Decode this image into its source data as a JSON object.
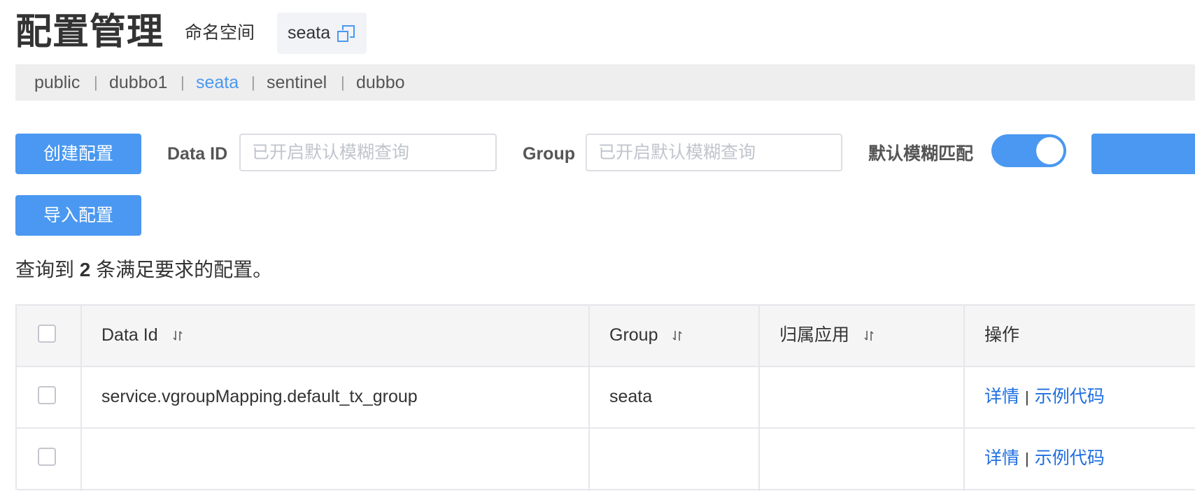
{
  "page": {
    "title": "配置管理"
  },
  "namespace": {
    "label": "命名空间",
    "current": "seata",
    "icon": "copy-icon",
    "tabs": [
      {
        "label": "public"
      },
      {
        "label": "dubbo1"
      },
      {
        "label": "seata"
      },
      {
        "label": "sentinel"
      },
      {
        "label": "dubbo"
      }
    ],
    "active_tab": "seata",
    "separator": "|"
  },
  "toolbar": {
    "create_label": "创建配置",
    "import_label": "导入配置",
    "dataid_label": "Data ID",
    "dataid_placeholder": "已开启默认模糊查询",
    "group_label": "Group",
    "group_placeholder": "已开启默认模糊查询",
    "fuzzy_label": "默认模糊匹配",
    "fuzzy_on": true
  },
  "result": {
    "prefix": "查询到",
    "count": "2",
    "suffix": "条满足要求的配置。"
  },
  "table": {
    "columns": [
      "Data Id",
      "Group",
      "归属应用",
      "操作"
    ],
    "rows": [
      {
        "data_id": "service.vgroupMapping.default_tx_group",
        "group": "seata",
        "app": "",
        "actions": [
          "详情",
          "示例代码"
        ]
      },
      {
        "data_id": "",
        "group": "",
        "app": "",
        "actions": [
          "详情",
          "示例代码"
        ]
      }
    ]
  },
  "colors": {
    "accent": "#4a98f1",
    "link": "#1f6fe0",
    "header_bg": "#f5f5f6"
  }
}
